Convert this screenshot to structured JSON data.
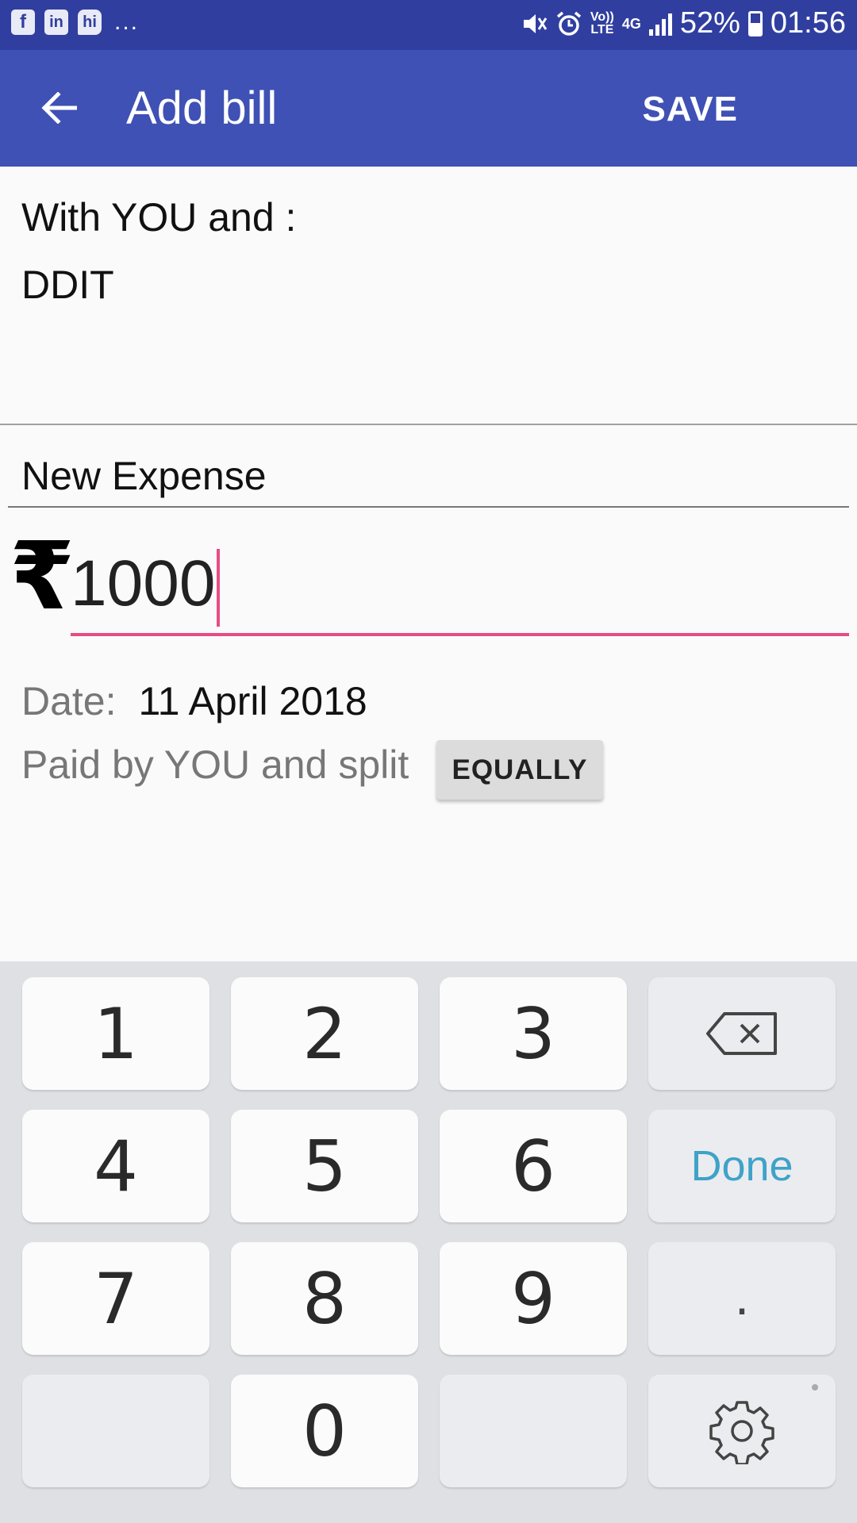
{
  "status_bar": {
    "app_icons": [
      "f",
      "in",
      "hi"
    ],
    "overflow": "...",
    "network_label_top": "Vo))",
    "network_label_bottom": "LTE",
    "network_type": "4G",
    "battery": "52%",
    "time": "01:56"
  },
  "app_bar": {
    "back_icon": "arrow-left-icon",
    "title": "Add bill",
    "save_label": "SAVE"
  },
  "participants": {
    "with_label": "With YOU and :",
    "group": "DDIT"
  },
  "expense": {
    "description": "New Expense",
    "currency_symbol": "₹",
    "amount": "1000"
  },
  "details": {
    "date_label": "Date:",
    "date_value": "11 April 2018",
    "split_text": "Paid by YOU and split",
    "split_button": "EQUALLY"
  },
  "keypad": {
    "k1": "1",
    "k2": "2",
    "k3": "3",
    "k4": "4",
    "k5": "5",
    "k6": "6",
    "k7": "7",
    "k8": "8",
    "k9": "9",
    "k0": "0",
    "done": "Done",
    "dot": ".",
    "icons": {
      "backspace": "backspace-icon",
      "settings": "gear-icon"
    }
  },
  "colors": {
    "status_bar": "#303f9f",
    "app_bar": "#3f51b5",
    "accent": "#e94b85",
    "done_text": "#3fa2c9"
  }
}
